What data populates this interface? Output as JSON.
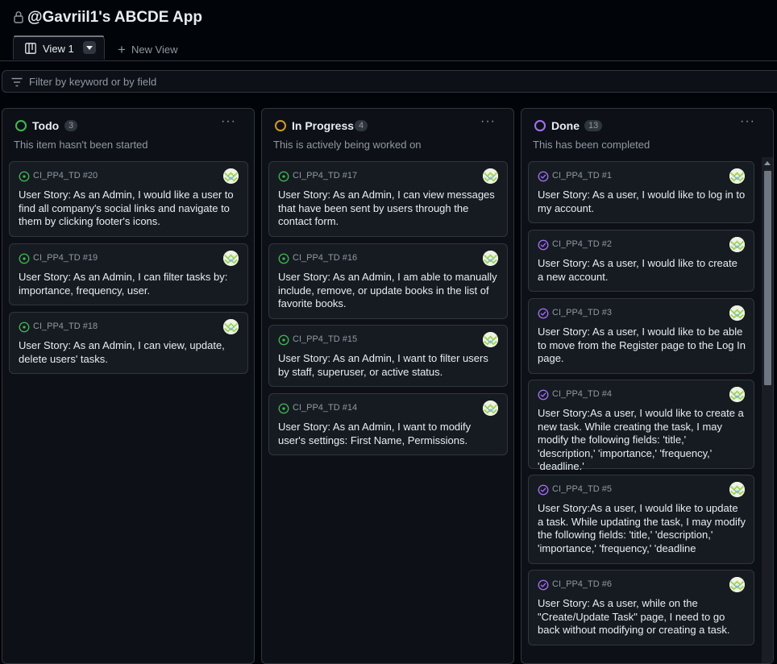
{
  "app": {
    "title": "@Gavriil1's ABCDE App"
  },
  "tabs": {
    "active_label": "View 1",
    "new_view_label": "New View"
  },
  "filter": {
    "placeholder": "Filter by keyword or by field"
  },
  "colors": {
    "todo": "#3fb950",
    "in_progress": "#d29922",
    "done": "#a371f7",
    "open_issue": "#3fb950",
    "closed_issue": "#a371f7"
  },
  "columns": [
    {
      "name": "Todo",
      "count": "3",
      "description": "This item hasn't been started",
      "cards": [
        {
          "id": "CI_PP4_TD #20",
          "text": "User Story: As an Admin, I would like a user to find all company's social links and navigate to them by clicking footer's icons."
        },
        {
          "id": "CI_PP4_TD #19",
          "text": "User Story: As an Admin, I can filter tasks by: importance, frequency, user."
        },
        {
          "id": "CI_PP4_TD #18",
          "text": "User Story: As an Admin, I can view, update, delete users' tasks."
        }
      ]
    },
    {
      "name": "In Progress",
      "count": "4",
      "description": "This is actively being worked on",
      "cards": [
        {
          "id": "CI_PP4_TD #17",
          "text": "User Story: As an Admin, I can view messages that have been sent by users through the contact form."
        },
        {
          "id": "CI_PP4_TD #16",
          "text": "User Story: As an Admin, I am able to manually include, remove, or update books in the list of favorite books."
        },
        {
          "id": "CI_PP4_TD #15",
          "text": "User Story: As an Admin, I want to filter users by staff, superuser, or active status."
        },
        {
          "id": "CI_PP4_TD #14",
          "text": "User Story: As an Admin, I want to modify user's settings: First Name, Permissions."
        }
      ]
    },
    {
      "name": "Done",
      "count": "13",
      "description": "This has been completed",
      "cards": [
        {
          "id": "CI_PP4_TD #1",
          "text": "User Story: As a user, I would like to log in to my account."
        },
        {
          "id": "CI_PP4_TD #2",
          "text": "User Story: As a user, I would like to create a new account."
        },
        {
          "id": "CI_PP4_TD #3",
          "text": "User Story: As a user, I would like to be able to move from the Register page to the Log In page."
        },
        {
          "id": "CI_PP4_TD #4",
          "text": "User Story:As a user, I would like to create a new task. While creating the task, I may modify the following fields: 'title,' 'description,' 'importance,' 'frequency,' 'deadline.'"
        },
        {
          "id": "CI_PP4_TD #5",
          "text": "User Story:As a user, I would like to update a task. While updating the task, I may modify the following fields: 'title,' 'description,' 'importance,' 'frequency,' 'deadline"
        },
        {
          "id": "CI_PP4_TD #6",
          "text": "User Story: As a user, while on the \"Create/Update Task\" page, I need to go back without modifying or creating a task."
        }
      ]
    }
  ]
}
